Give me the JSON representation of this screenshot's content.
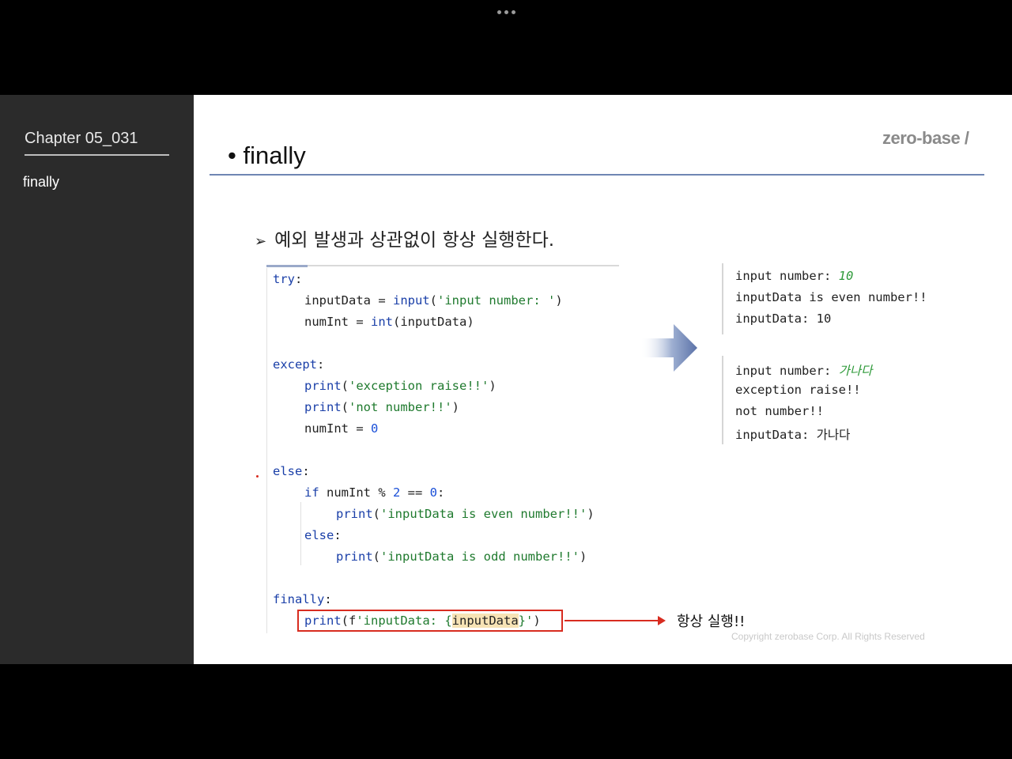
{
  "toolbar": {
    "more_icon": "ellipsis-icon"
  },
  "sidebar": {
    "chapter": "Chapter  05_031",
    "topic": "finally"
  },
  "brand": "zero-base /",
  "slide": {
    "title": "• finally",
    "bullet_mark": "➢",
    "bullet_text": "예외 발생과 상관없이 항상 실행한다.",
    "always_label": "항상 실행!!",
    "copyright": "Copyright zerobase Corp. All Rights Reserved"
  },
  "code": {
    "try_kw": "try",
    "l1_var": "inputData = ",
    "l1_fn": "input",
    "l1_open": "(",
    "l1_str": "'input number: '",
    "l1_close": ")",
    "l2_var": "numInt = ",
    "l2_fn": "int",
    "l2_rest": "(inputData)",
    "except_kw": "except",
    "e1_fn": "print",
    "e1_str": "'exception raise!!'",
    "e2_fn": "print",
    "e2_str": "'not number!!'",
    "e3_var": "numInt = ",
    "e3_num": "0",
    "else_kw": "else",
    "if_kw": "if",
    "if_mid": " numInt % ",
    "if_num1": "2",
    "if_eq": " == ",
    "if_num2": "0",
    "p1_fn": "print",
    "p1_str": "'inputData is even number!!'",
    "else2_kw": "else",
    "p2_fn": "print",
    "p2_str": "'inputData is odd number!!'",
    "finally_kw": "finally",
    "f_fn": "print",
    "f_open": "(f",
    "f_str1": "'inputData: {",
    "f_var": "inputData",
    "f_str2": "}'",
    "f_close": ")",
    "colon": ":",
    "paren_open": "(",
    "paren_close": ")"
  },
  "output1": {
    "l1_prompt": "input number: ",
    "l1_input": "10",
    "l2": "inputData is even number!!",
    "l3": "inputData: 10"
  },
  "output2": {
    "l1_prompt": "input number: ",
    "l1_input": "가나다",
    "l2": "exception raise!!",
    "l3": "not number!!",
    "l4": "inputData: 가나다"
  },
  "colors": {
    "sidebar_bg": "#2b2b2b",
    "title_rule": "#6f86b3",
    "highlight_red": "#d82c20",
    "keyword_blue": "#1a3fa8",
    "string_green": "#1f7a2e"
  }
}
